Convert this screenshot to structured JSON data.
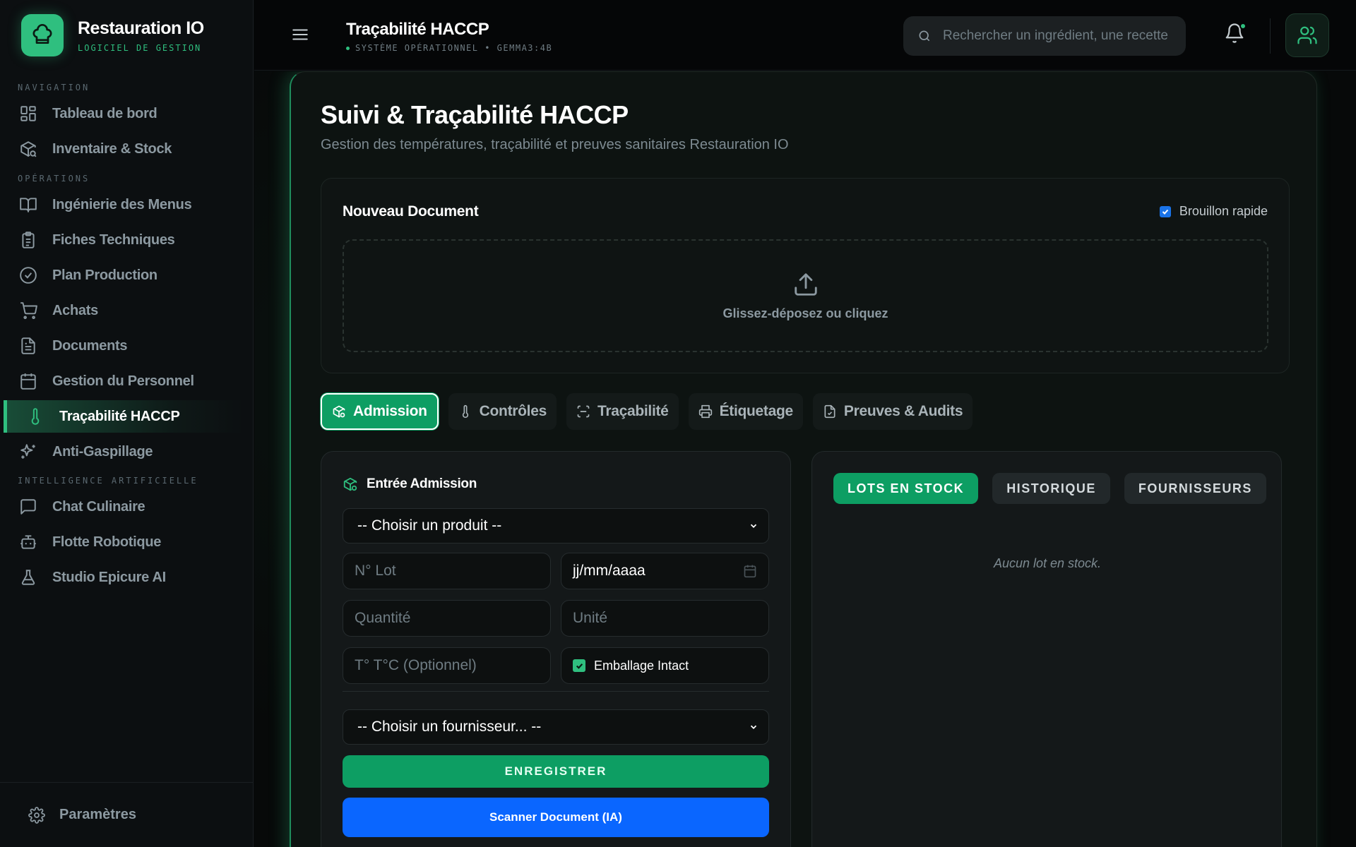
{
  "brand": {
    "title": "Restauration IO",
    "subtitle": "LOGICIEL DE GESTION"
  },
  "sidebar": {
    "sections": {
      "navigation": "NAVIGATION",
      "operations": "OPÉRATIONS",
      "ai": "INTELLIGENCE ARTIFICIELLE"
    },
    "items": [
      {
        "label": "Tableau de bord",
        "icon": "dashboard-icon"
      },
      {
        "label": "Inventaire & Stock",
        "icon": "package-search-icon"
      },
      {
        "label": "Ingénierie des Menus",
        "icon": "book-open-icon"
      },
      {
        "label": "Fiches Techniques",
        "icon": "clipboard-icon"
      },
      {
        "label": "Plan Production",
        "icon": "check-circle-icon"
      },
      {
        "label": "Achats",
        "icon": "cart-icon"
      },
      {
        "label": "Documents",
        "icon": "file-text-icon"
      },
      {
        "label": "Gestion du Personnel",
        "icon": "calendar-icon"
      },
      {
        "label": "Traçabilité HACCP",
        "icon": "thermometer-icon",
        "active": true
      },
      {
        "label": "Anti-Gaspillage",
        "icon": "sparkles-icon"
      },
      {
        "label": "Chat Culinaire",
        "icon": "message-square-icon"
      },
      {
        "label": "Flotte Robotique",
        "icon": "bot-icon"
      },
      {
        "label": "Studio Epicure AI",
        "icon": "flask-icon"
      }
    ],
    "settings_label": "Paramètres"
  },
  "header": {
    "title": "Traçabilité HACCP",
    "subtitle": "SYSTÈME OPÉRATIONNEL • GEMMA3:4B",
    "search_placeholder": "Rechercher un ingrédient, une recette..."
  },
  "page": {
    "title": "Suivi & Traçabilité HACCP",
    "subtitle": "Gestion des températures, traçabilité et preuves sanitaires Restauration IO"
  },
  "new_document": {
    "title": "Nouveau Document",
    "quick_draft_label": "Brouillon rapide",
    "quick_draft_checked": true,
    "dropzone_text": "Glissez-déposez ou cliquez"
  },
  "tabs": [
    {
      "label": "Admission",
      "icon": "package-icon",
      "active": true
    },
    {
      "label": "Contrôles",
      "icon": "thermometer-icon"
    },
    {
      "label": "Traçabilité",
      "icon": "scan-icon"
    },
    {
      "label": "Étiquetage",
      "icon": "printer-icon"
    },
    {
      "label": "Preuves & Audits",
      "icon": "file-check-icon"
    }
  ],
  "admission_form": {
    "title": "Entrée Admission",
    "product_select": "-- Choisir un produit --",
    "lot_placeholder": "N° Lot",
    "date_value": "jj/mm/aaaa",
    "quantity_placeholder": "Quantité",
    "unit_placeholder": "Unité",
    "temperature_placeholder": "T° T°C (Optionnel)",
    "packaging_label": "Emballage Intact",
    "packaging_checked": true,
    "supplier_select": "-- Choisir un fournisseur... --",
    "save_label": "ENREGISTRER",
    "scan_label": "Scanner Document (IA)"
  },
  "stock_panel": {
    "tabs": [
      "LOTS EN STOCK",
      "HISTORIQUE",
      "FOURNISSEURS"
    ],
    "active_tab": "LOTS EN STOCK",
    "empty_text": "Aucun lot en stock."
  },
  "colors": {
    "accent": "#2fbf7f",
    "accent_dark": "#0d9e63",
    "scan_button": "#0a66ff",
    "background": "#07090a"
  }
}
